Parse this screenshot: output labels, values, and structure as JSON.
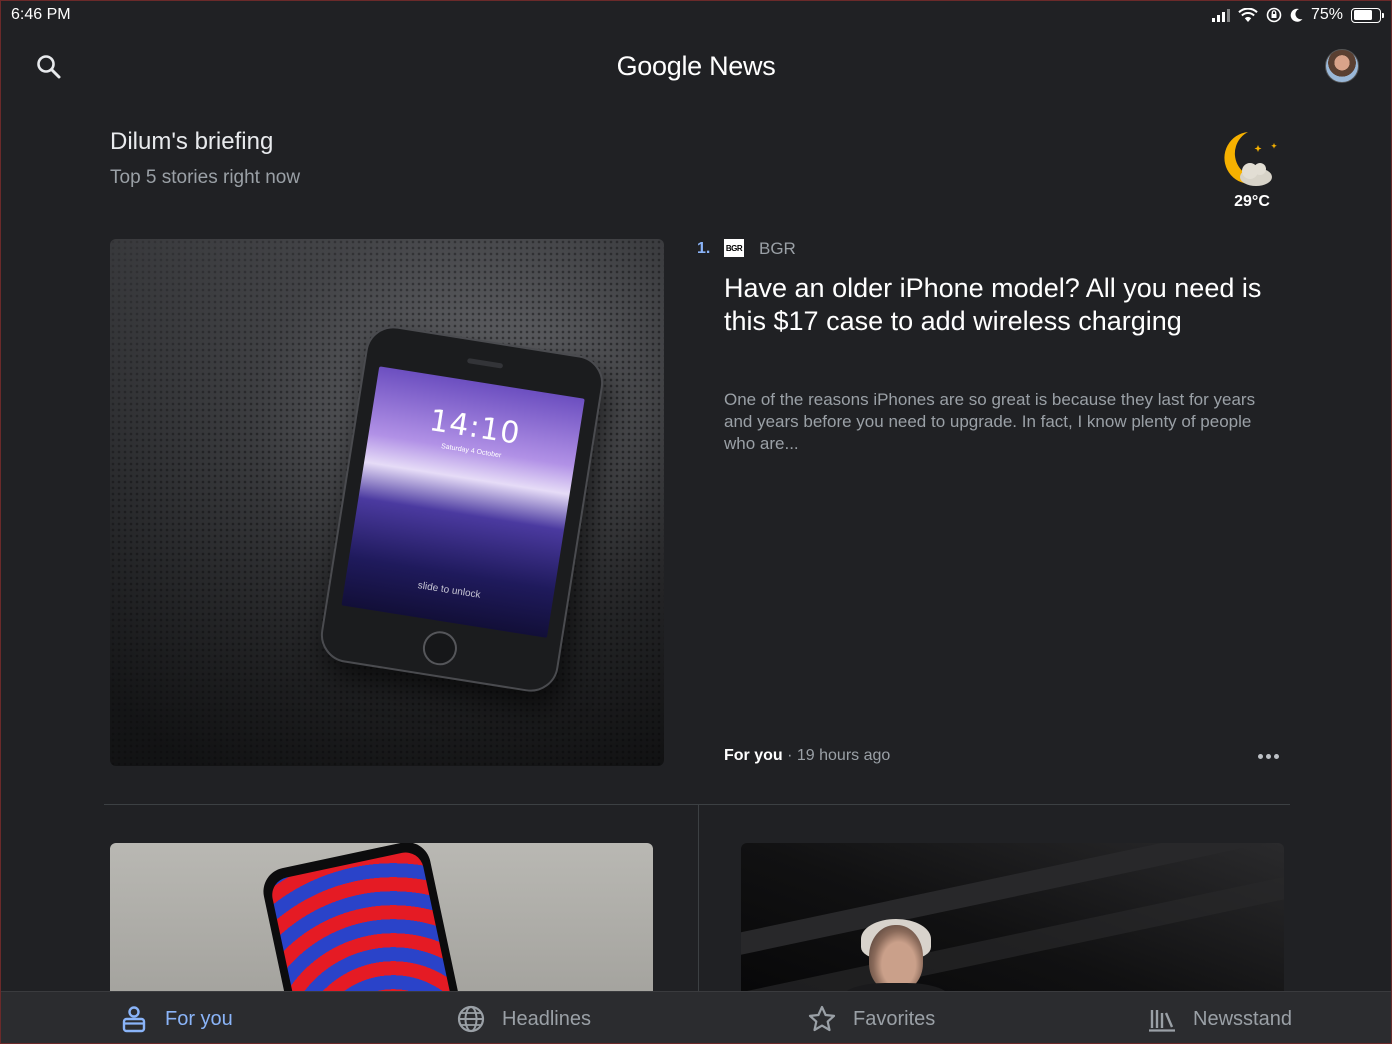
{
  "status_bar": {
    "time": "6:46 PM",
    "battery_percent_label": "75%",
    "battery_level": 0.75
  },
  "header": {
    "title": "Google News"
  },
  "briefing": {
    "title": "Dilum's briefing",
    "subtitle": "Top 5 stories right now"
  },
  "weather": {
    "icon": "moon-cloud-icon",
    "temperature": "29°C"
  },
  "hero_story": {
    "rank": "1.",
    "source_logo_text": "BGR",
    "source_name": "BGR",
    "headline": "Have an older iPhone model? All you need is this $17 case to add wireless charging",
    "snippet": "One of the reasons iPhones are so great is because they last for years and years before you need to upgrade. In fact, I know plenty of people who are...",
    "section": "For you",
    "separator": " · ",
    "time_ago": "19 hours ago",
    "image": {
      "phone_time": "14:10",
      "phone_date": "Saturday 4 October",
      "phone_unlock_text": "slide to unlock"
    }
  },
  "bottom_nav": {
    "items": [
      {
        "label": "For you",
        "icon": "person-badge-icon",
        "active": true
      },
      {
        "label": "Headlines",
        "icon": "globe-icon",
        "active": false
      },
      {
        "label": "Favorites",
        "icon": "star-icon",
        "active": false
      },
      {
        "label": "Newsstand",
        "icon": "newsstand-icon",
        "active": false
      }
    ]
  },
  "colors": {
    "background": "#202124",
    "accent": "#8ab4f8",
    "text_primary": "#ffffff",
    "text_secondary": "#9aa0a6",
    "weather_moon": "#f6b100"
  }
}
